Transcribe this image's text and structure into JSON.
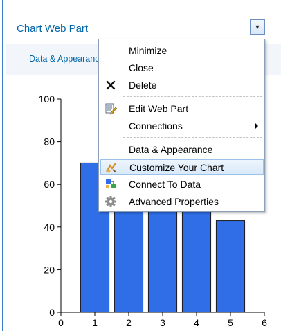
{
  "webpart": {
    "title": "Chart Web Part",
    "toolbar_link": "Data & Appearance",
    "menu_button_glyph": "▼"
  },
  "menu": {
    "items": [
      {
        "label": "Minimize",
        "icon": null
      },
      {
        "label": "Close",
        "icon": null
      },
      {
        "label": "Delete",
        "icon": "delete-x-icon"
      },
      {
        "label": "Edit Web Part",
        "icon": "edit-web-part-icon"
      },
      {
        "label": "Connections",
        "icon": null,
        "submenu": true
      },
      {
        "label": "Data & Appearance",
        "icon": null
      },
      {
        "label": "Customize Your Chart",
        "icon": "customize-chart-icon",
        "highlighted": true
      },
      {
        "label": "Connect To Data",
        "icon": "connect-data-icon"
      },
      {
        "label": "Advanced Properties",
        "icon": "gear-icon"
      }
    ]
  },
  "chart_data": {
    "type": "bar",
    "x": [
      1,
      2,
      3,
      4,
      5
    ],
    "values": [
      70,
      62,
      60,
      58,
      43
    ],
    "xlim": [
      0,
      6
    ],
    "ylim": [
      0,
      100
    ],
    "xticks": [
      "0",
      "1",
      "2",
      "3",
      "4",
      "5",
      "6"
    ],
    "yticks": [
      "0",
      "20",
      "40",
      "60",
      "80",
      "100"
    ],
    "bar_color": "#2f6ee6",
    "grid": false
  },
  "colors": {
    "accent": "#0066aa",
    "highlight": "#d9e9fa"
  }
}
